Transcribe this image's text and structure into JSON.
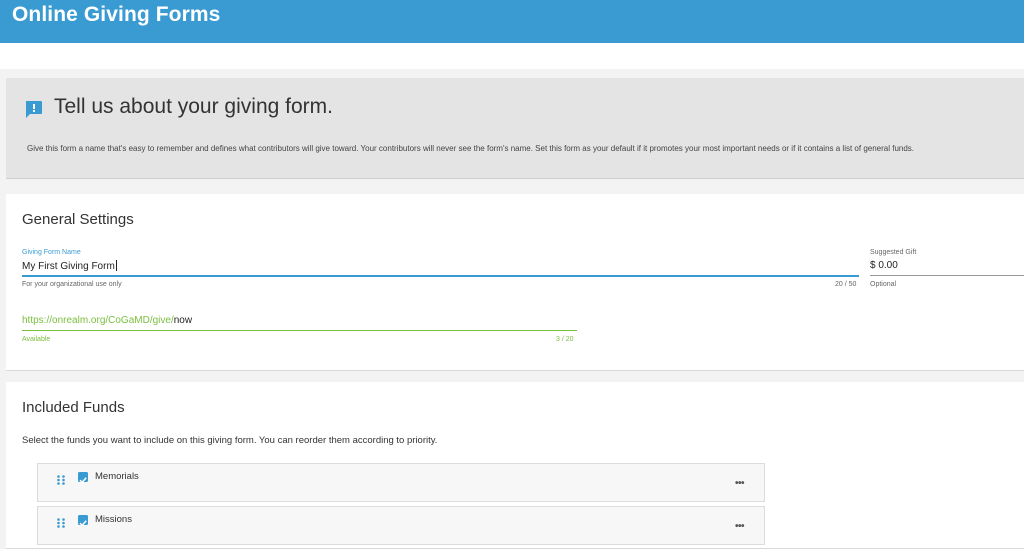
{
  "app": {
    "title": "Online Giving Forms"
  },
  "intro": {
    "heading": "Tell us about your giving form.",
    "description": "Give this form a name that's easy to remember and defines what contributors will give toward. Your contributors will never see the form's name. Set this form as your default if it promotes your most important needs or if it contains a list of general funds."
  },
  "general_settings": {
    "title": "General Settings",
    "name_field": {
      "label": "Giving Form Name",
      "value": "My First Giving Form",
      "helper": "For your organizational use only",
      "counter": "20 / 50"
    },
    "gift_field": {
      "label": "Suggested Gift",
      "value": "$ 0.00",
      "helper": "Optional"
    },
    "url_field": {
      "prefix": "https://onrealm.org/CoGaMD/give/",
      "slug": "now",
      "helper": "Available",
      "counter": "3 / 20"
    }
  },
  "included_funds": {
    "title": "Included Funds",
    "description": "Select the funds you want to include on this giving form. You can reorder them according to priority.",
    "funds": [
      {
        "name": "Memorials",
        "checked": true,
        "more": "•••"
      },
      {
        "name": "Missions",
        "checked": true,
        "more": "•••"
      }
    ]
  },
  "colors": {
    "accent": "#3a9bd2",
    "success": "#7bbf3f",
    "header": "#3a9bd2"
  },
  "icons": {
    "intro": "comment-alert-icon",
    "drag": "drag-handle-icon",
    "check": "checkbox-checked-icon",
    "more": "more-horizontal-icon"
  }
}
